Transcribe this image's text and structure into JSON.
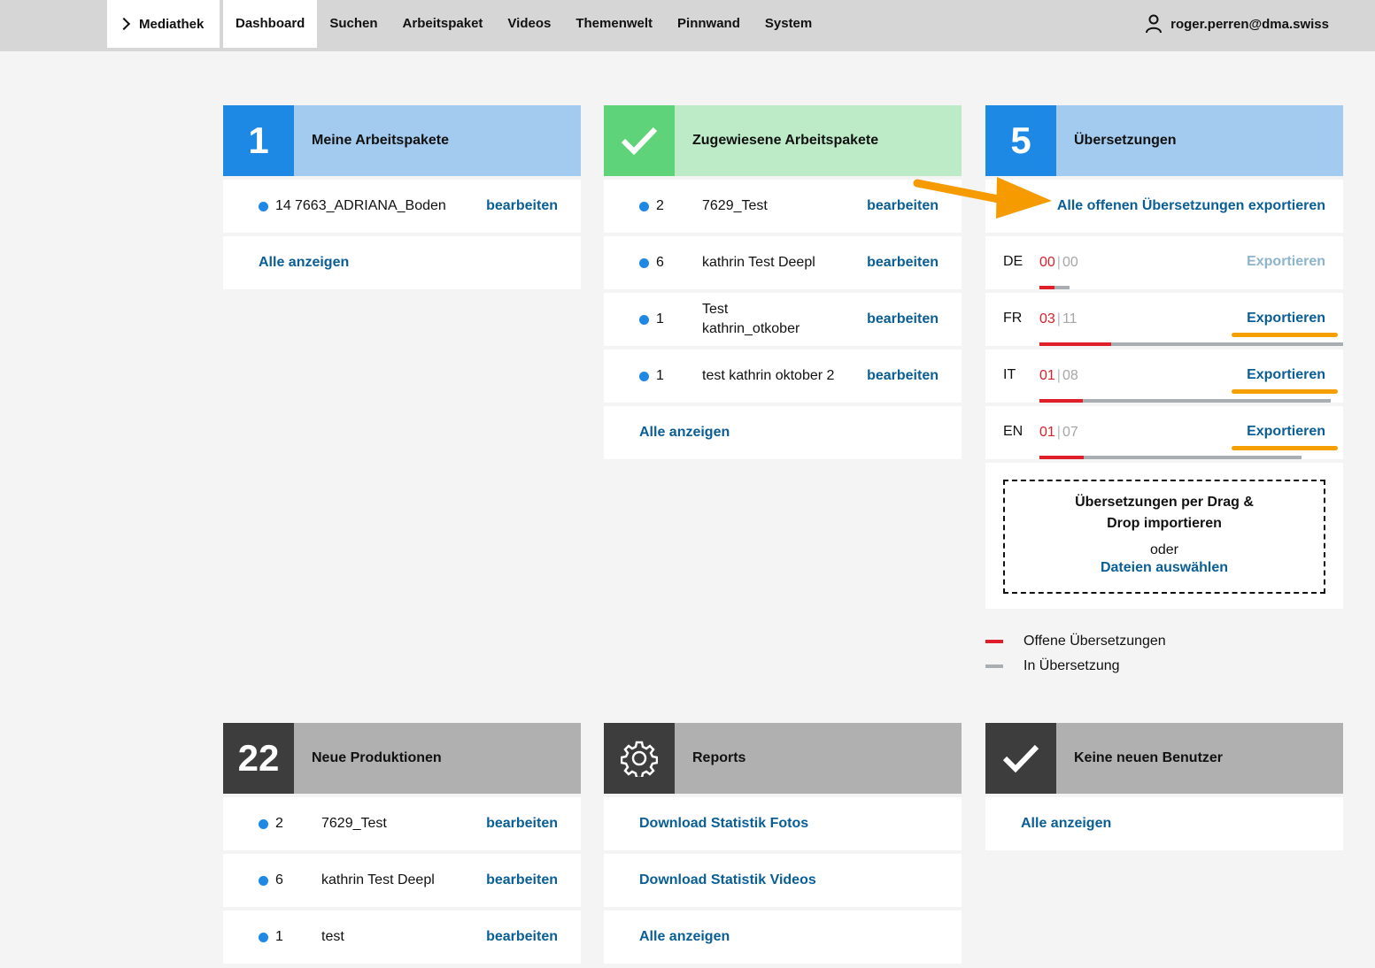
{
  "topnav": {
    "mediathek": "Mediathek",
    "items": [
      "Dashboard",
      "Suchen",
      "Arbeitspaket",
      "Videos",
      "Themenwelt",
      "Pinnwand",
      "System"
    ],
    "user": "roger.perren@dma.swiss"
  },
  "meine": {
    "badge": "1",
    "title": "Meine Arbeitspakete",
    "items": [
      {
        "count": "14",
        "name": "7663_ADRIANA_Boden",
        "action": "bearbeiten"
      }
    ],
    "show_all": "Alle anzeigen"
  },
  "zugewiesene": {
    "title": "Zugewiesene Arbeitspakete",
    "items": [
      {
        "count": "2",
        "name": "7629_Test",
        "action": "bearbeiten"
      },
      {
        "count": "6",
        "name": "kathrin Test Deepl",
        "action": "bearbeiten"
      },
      {
        "count": "1",
        "name": "Test kathrin_otkober",
        "action": "bearbeiten"
      },
      {
        "count": "1",
        "name": "test kathrin oktober 2",
        "action": "bearbeiten"
      }
    ],
    "show_all": "Alle anzeigen"
  },
  "uebersetzungen": {
    "badge": "5",
    "title": "Übersetzungen",
    "export_all": "Alle offenen Übersetzungen exportieren",
    "languages": [
      {
        "code": "DE",
        "open": "00",
        "in_translation": "00",
        "export": "Exportieren",
        "open_fraction": 0.5,
        "enabled": false
      },
      {
        "code": "FR",
        "open": "03",
        "in_translation": "11",
        "export": "Exportieren",
        "open_fraction": 0.235,
        "enabled": true
      },
      {
        "code": "IT",
        "open": "01",
        "in_translation": "08",
        "export": "Exportieren",
        "open_fraction": 0.15,
        "enabled": true
      },
      {
        "code": "EN",
        "open": "01",
        "in_translation": "07",
        "export": "Exportieren",
        "open_fraction": 0.17,
        "enabled": true
      }
    ],
    "drop_title": "Übersetzungen per Drag & Drop importieren",
    "drop_or": "oder",
    "drop_select": "Dateien auswählen",
    "legend": [
      {
        "label": "Offene Übersetzungen",
        "color": "#e01e2a"
      },
      {
        "label": "In Übersetzung",
        "color": "#a9aeb3"
      }
    ]
  },
  "neue": {
    "badge": "22",
    "title": "Neue Produktionen",
    "items": [
      {
        "count": "2",
        "name": "7629_Test",
        "action": "bearbeiten"
      },
      {
        "count": "6",
        "name": "kathrin Test Deepl",
        "action": "bearbeiten"
      },
      {
        "count": "1",
        "name": "test",
        "action": "bearbeiten"
      }
    ]
  },
  "reports": {
    "title": "Reports",
    "links": [
      "Download Statistik Fotos",
      "Download Statistik Videos",
      "Alle anzeigen"
    ]
  },
  "benutzer": {
    "title": "Keine neuen Benutzer",
    "show_all": "Alle anzeigen"
  },
  "colors": {
    "accent_blue": "#1e88e5",
    "link": "#0a5e96",
    "open_red": "#e01e2a",
    "highlight": "#f5a000"
  }
}
